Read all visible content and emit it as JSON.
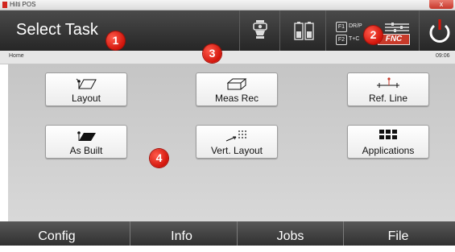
{
  "window": {
    "title": "Hilti POS",
    "close_glyph": "x",
    "app_icon": "hilti-app-icon"
  },
  "header": {
    "title": "Select Task",
    "status_icons": [
      "total-station-icon",
      "battery-icon"
    ],
    "f1_key": "F1",
    "f1_label": "DR/P",
    "f2_key": "F2",
    "f2_label": "T+C",
    "fnc_label": "FNC",
    "power_icon": "power-icon",
    "accent_color": "#d2150b"
  },
  "breadcrumb": {
    "path": "Home",
    "time": "09:06"
  },
  "callouts": [
    "1",
    "2",
    "3",
    "4"
  ],
  "tasks": [
    {
      "label": "Layout",
      "icon": "layout-icon"
    },
    {
      "label": "Meas Rec",
      "icon": "meas-rec-icon"
    },
    {
      "label": "Ref. Line",
      "icon": "ref-line-icon"
    },
    {
      "label": "As Built",
      "icon": "as-built-icon"
    },
    {
      "label": "Vert. Layout",
      "icon": "vert-layout-icon"
    },
    {
      "label": "Applications",
      "icon": "applications-icon"
    }
  ],
  "bottom_tabs": [
    {
      "label": "Config"
    },
    {
      "label": "Info"
    },
    {
      "label": "Jobs"
    },
    {
      "label": "File"
    }
  ]
}
